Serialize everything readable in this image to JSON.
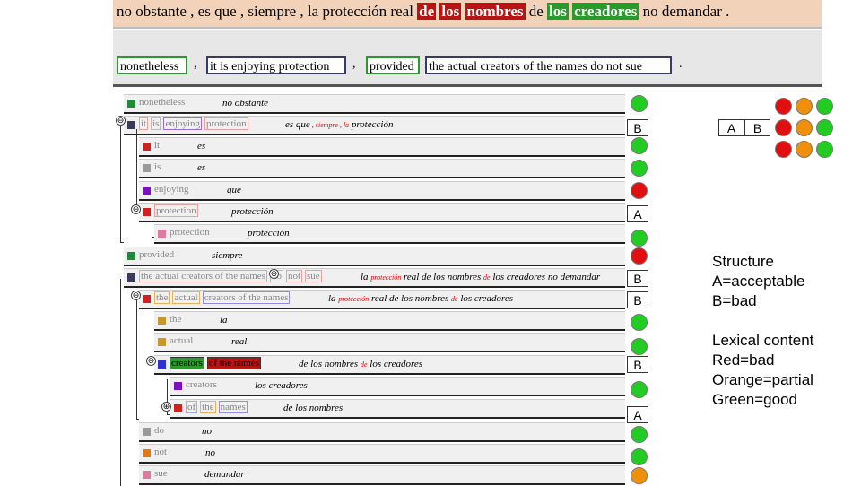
{
  "source": {
    "segments": [
      {
        "text": "no obstante , es que , siempre , la protección real ",
        "hl": ""
      },
      {
        "text": "de",
        "hl": "#b81414"
      },
      {
        "text": " ",
        "hl": ""
      },
      {
        "text": "los",
        "hl": "#b81414"
      },
      {
        "text": " ",
        "hl": ""
      },
      {
        "text": "nombres",
        "hl": "#b81414"
      },
      {
        "text": " de ",
        "hl": ""
      },
      {
        "text": "los",
        "hl": "#2a9a2a"
      },
      {
        "text": " ",
        "hl": ""
      },
      {
        "text": "creadores",
        "hl": "#2a9a2a"
      },
      {
        "text": " no demandar .",
        "hl": ""
      }
    ]
  },
  "target_chunks": [
    {
      "text": "nonetheless",
      "color": "#2a9a2a"
    },
    {
      "text": "it is enjoying protection",
      "color": "#3a3a6a"
    },
    {
      "text": "provided",
      "color": "#2a9a2a"
    },
    {
      "text": "the actual creators of the names do not sue",
      "color": "#3a3a6a"
    }
  ],
  "separators": {
    "comma": ",",
    "period": "."
  },
  "toggles": {
    "expanded": "⊖",
    "collapsed": "⊕"
  },
  "rows": [
    {
      "sq": "#1f8a3a",
      "words": [
        {
          "t": "nonetheless",
          "b": ""
        }
      ],
      "es": [
        {
          "t": "no obstante",
          "c": ""
        }
      ],
      "status": {
        "kind": "dot",
        "value": "#22cc22"
      }
    },
    {
      "sq": "#3a3a5a",
      "words": [
        {
          "t": "it",
          "b": "#e8a0a0"
        },
        {
          "t": "is",
          "b": "#bbbbbb"
        },
        {
          "t": "enjoying",
          "b": "#9a6ad6"
        },
        {
          "t": "protection",
          "b": "#e8a0a0"
        }
      ],
      "es": [
        {
          "t": "es que",
          "c": ""
        },
        {
          "t": " , ",
          "c": "#d00",
          "s": true
        },
        {
          "t": "siempre",
          "c": "#d00",
          "s": true
        },
        {
          "t": " , ",
          "c": "#d00",
          "s": true
        },
        {
          "t": "la",
          "c": "#d00",
          "s": true
        },
        {
          "t": " protección",
          "c": ""
        }
      ],
      "status": {
        "kind": "label",
        "value": "B"
      }
    },
    {
      "sq": "#d02020",
      "words": [
        {
          "t": "it",
          "b": ""
        }
      ],
      "es": [
        {
          "t": "es",
          "c": ""
        }
      ],
      "status": {
        "kind": "dot",
        "value": "#22cc22"
      }
    },
    {
      "sq": "#9a9a9a",
      "words": [
        {
          "t": "is",
          "b": ""
        }
      ],
      "es": [
        {
          "t": "es",
          "c": ""
        }
      ],
      "status": {
        "kind": "dot",
        "value": "#22cc22"
      }
    },
    {
      "sq": "#7a10c0",
      "words": [
        {
          "t": "enjoying",
          "b": ""
        }
      ],
      "es": [
        {
          "t": "que",
          "c": ""
        }
      ],
      "status": {
        "kind": "dot",
        "value": "#e01010"
      }
    },
    {
      "sq": "#d02020",
      "words": [
        {
          "t": "protection",
          "b": "#e8a0a0"
        }
      ],
      "es": [
        {
          "t": "protección",
          "c": ""
        }
      ],
      "status": {
        "kind": "label",
        "value": "A"
      }
    },
    {
      "sq": "#e07aa0",
      "words": [
        {
          "t": "protection",
          "b": ""
        }
      ],
      "es": [
        {
          "t": "protección",
          "c": ""
        }
      ],
      "status": {
        "kind": "dot",
        "value": "#22cc22"
      }
    },
    {
      "sq": "#1f8a3a",
      "words": [
        {
          "t": "provided",
          "b": ""
        }
      ],
      "es": [
        {
          "t": "siempre",
          "c": ""
        }
      ],
      "status": {
        "kind": "dot",
        "value": "#e01010"
      }
    },
    {
      "sq": "#3a3a5a",
      "words": [
        {
          "t": "the actual creators of the names",
          "b": "#e8a0a0"
        },
        {
          "t": "do",
          "b": "#bbbbbb"
        },
        {
          "t": "not",
          "b": "#e8a0a0"
        },
        {
          "t": "sue",
          "b": "#e8a0a0"
        }
      ],
      "es": [
        {
          "t": "la ",
          "c": ""
        },
        {
          "t": "protección",
          "c": "#d00",
          "s": true
        },
        {
          "t": " real de los nombres ",
          "c": ""
        },
        {
          "t": "de",
          "c": "#d00",
          "s": true
        },
        {
          "t": " los creadores no demandar",
          "c": ""
        }
      ],
      "status": {
        "kind": "label",
        "value": "B"
      }
    },
    {
      "sq": "#d02020",
      "words": [
        {
          "t": "the",
          "b": "#e6b35a"
        },
        {
          "t": "actual",
          "b": "#e6b35a"
        },
        {
          "t": "creators of the names",
          "b": "#9a8ae6"
        }
      ],
      "es": [
        {
          "t": "la ",
          "c": ""
        },
        {
          "t": "protección",
          "c": "#d00",
          "s": true
        },
        {
          "t": " real de los nombres ",
          "c": ""
        },
        {
          "t": "de",
          "c": "#d00",
          "s": true
        },
        {
          "t": " los creadores",
          "c": ""
        }
      ],
      "status": {
        "kind": "label",
        "value": "B"
      }
    },
    {
      "sq": "#c8962a",
      "words": [
        {
          "t": "the",
          "b": ""
        }
      ],
      "es": [
        {
          "t": "la",
          "c": ""
        }
      ],
      "status": {
        "kind": "dot",
        "value": "#22cc22"
      }
    },
    {
      "sq": "#c8962a",
      "words": [
        {
          "t": "actual",
          "b": ""
        }
      ],
      "es": [
        {
          "t": "real",
          "c": ""
        }
      ],
      "status": {
        "kind": "dot",
        "value": "#22cc22"
      }
    },
    {
      "sq": "#3030d0",
      "words": [
        {
          "t": "creators",
          "b": "",
          "fill": "#2a9a2a"
        },
        {
          "t": "of the names",
          "b": "",
          "fill": "#b81414"
        }
      ],
      "es": [
        {
          "t": "de los nombres ",
          "c": ""
        },
        {
          "t": "de",
          "c": "#d00",
          "s": true
        },
        {
          "t": " los creadores",
          "c": ""
        }
      ],
      "status": {
        "kind": "label",
        "value": "B"
      }
    },
    {
      "sq": "#7a10c0",
      "words": [
        {
          "t": "creators",
          "b": ""
        }
      ],
      "es": [
        {
          "t": "los creadores",
          "c": ""
        }
      ],
      "status": {
        "kind": "dot",
        "value": "#22cc22"
      }
    },
    {
      "sq": "#d02020",
      "words": [
        {
          "t": "of",
          "b": "#9ab0e6"
        },
        {
          "t": "the",
          "b": "#e6b35a"
        },
        {
          "t": "names",
          "b": "#9a8ae6"
        }
      ],
      "es": [
        {
          "t": "de los nombres",
          "c": ""
        }
      ],
      "status": {
        "kind": "label",
        "value": "A"
      }
    },
    {
      "sq": "#9a9a9a",
      "words": [
        {
          "t": "do",
          "b": ""
        }
      ],
      "es": [
        {
          "t": "no",
          "c": ""
        }
      ],
      "status": {
        "kind": "dot",
        "value": "#22cc22"
      }
    },
    {
      "sq": "#e07a10",
      "words": [
        {
          "t": "not",
          "b": ""
        }
      ],
      "es": [
        {
          "t": "no",
          "c": ""
        }
      ],
      "status": {
        "kind": "dot",
        "value": "#22cc22"
      }
    },
    {
      "sq": "#e07aa0",
      "words": [
        {
          "t": "sue",
          "b": ""
        }
      ],
      "es": [
        {
          "t": "demandar",
          "c": ""
        }
      ],
      "status": {
        "kind": "dot",
        "value": "#f0900a"
      }
    }
  ],
  "legend_key": {
    "labels": [
      "A",
      "B"
    ],
    "dot_colors": [
      [
        "#e01010",
        "#f0900a",
        "#22cc22"
      ],
      [
        "#e01010",
        "#f0900a",
        "#22cc22"
      ],
      [
        "#e01010",
        "#f0900a",
        "#22cc22"
      ]
    ]
  },
  "legend": {
    "structure": {
      "title": "Structure",
      "a": "A=acceptable",
      "b": "B=bad"
    },
    "lexical": {
      "title": "Lexical content",
      "red": "Red=bad",
      "orange": "Orange=partial",
      "green": "Green=good"
    }
  }
}
